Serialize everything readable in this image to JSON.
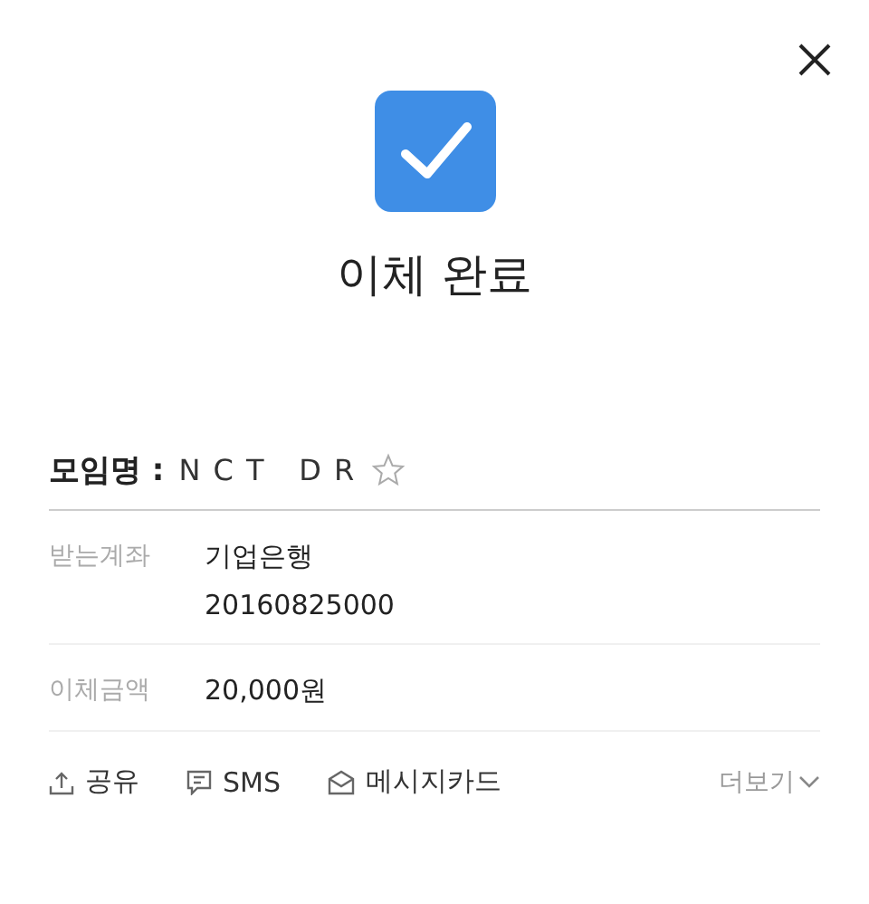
{
  "title": "이체 완료",
  "group": {
    "label": "모임명 :",
    "name": "N C T   D R",
    "favorite": false
  },
  "details": [
    {
      "label": "받는계좌",
      "lines": [
        "기업은행",
        "20160825000"
      ]
    },
    {
      "label": "이체금액",
      "lines": [
        "20,000원"
      ]
    }
  ],
  "actions": [
    {
      "kind": "share",
      "label": "공유"
    },
    {
      "kind": "sms",
      "label": "SMS"
    },
    {
      "kind": "card",
      "label": "메시지카드"
    }
  ],
  "more": {
    "label": "더보기"
  }
}
